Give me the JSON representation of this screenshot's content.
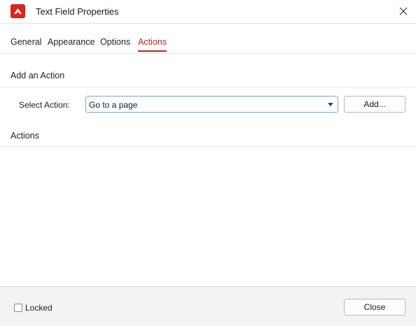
{
  "window": {
    "title": "Text Field Properties",
    "icon": "app-logo-icon",
    "close_icon": "close-icon"
  },
  "tabs": [
    {
      "label": "General",
      "active": false
    },
    {
      "label": "Appearance",
      "active": false
    },
    {
      "label": "Options",
      "active": false
    },
    {
      "label": "Actions",
      "active": true
    }
  ],
  "add_action": {
    "heading": "Add an Action",
    "select_label": "Select Action:",
    "select_value": "Go to a page",
    "add_button": "Add..."
  },
  "actions": {
    "heading": "Actions",
    "items": []
  },
  "footer": {
    "locked_label": "Locked",
    "locked_checked": false,
    "close_button": "Close"
  },
  "colors": {
    "accent": "#c3211a",
    "app_icon": "#d9251c",
    "focus_border": "#7aa7d6"
  }
}
